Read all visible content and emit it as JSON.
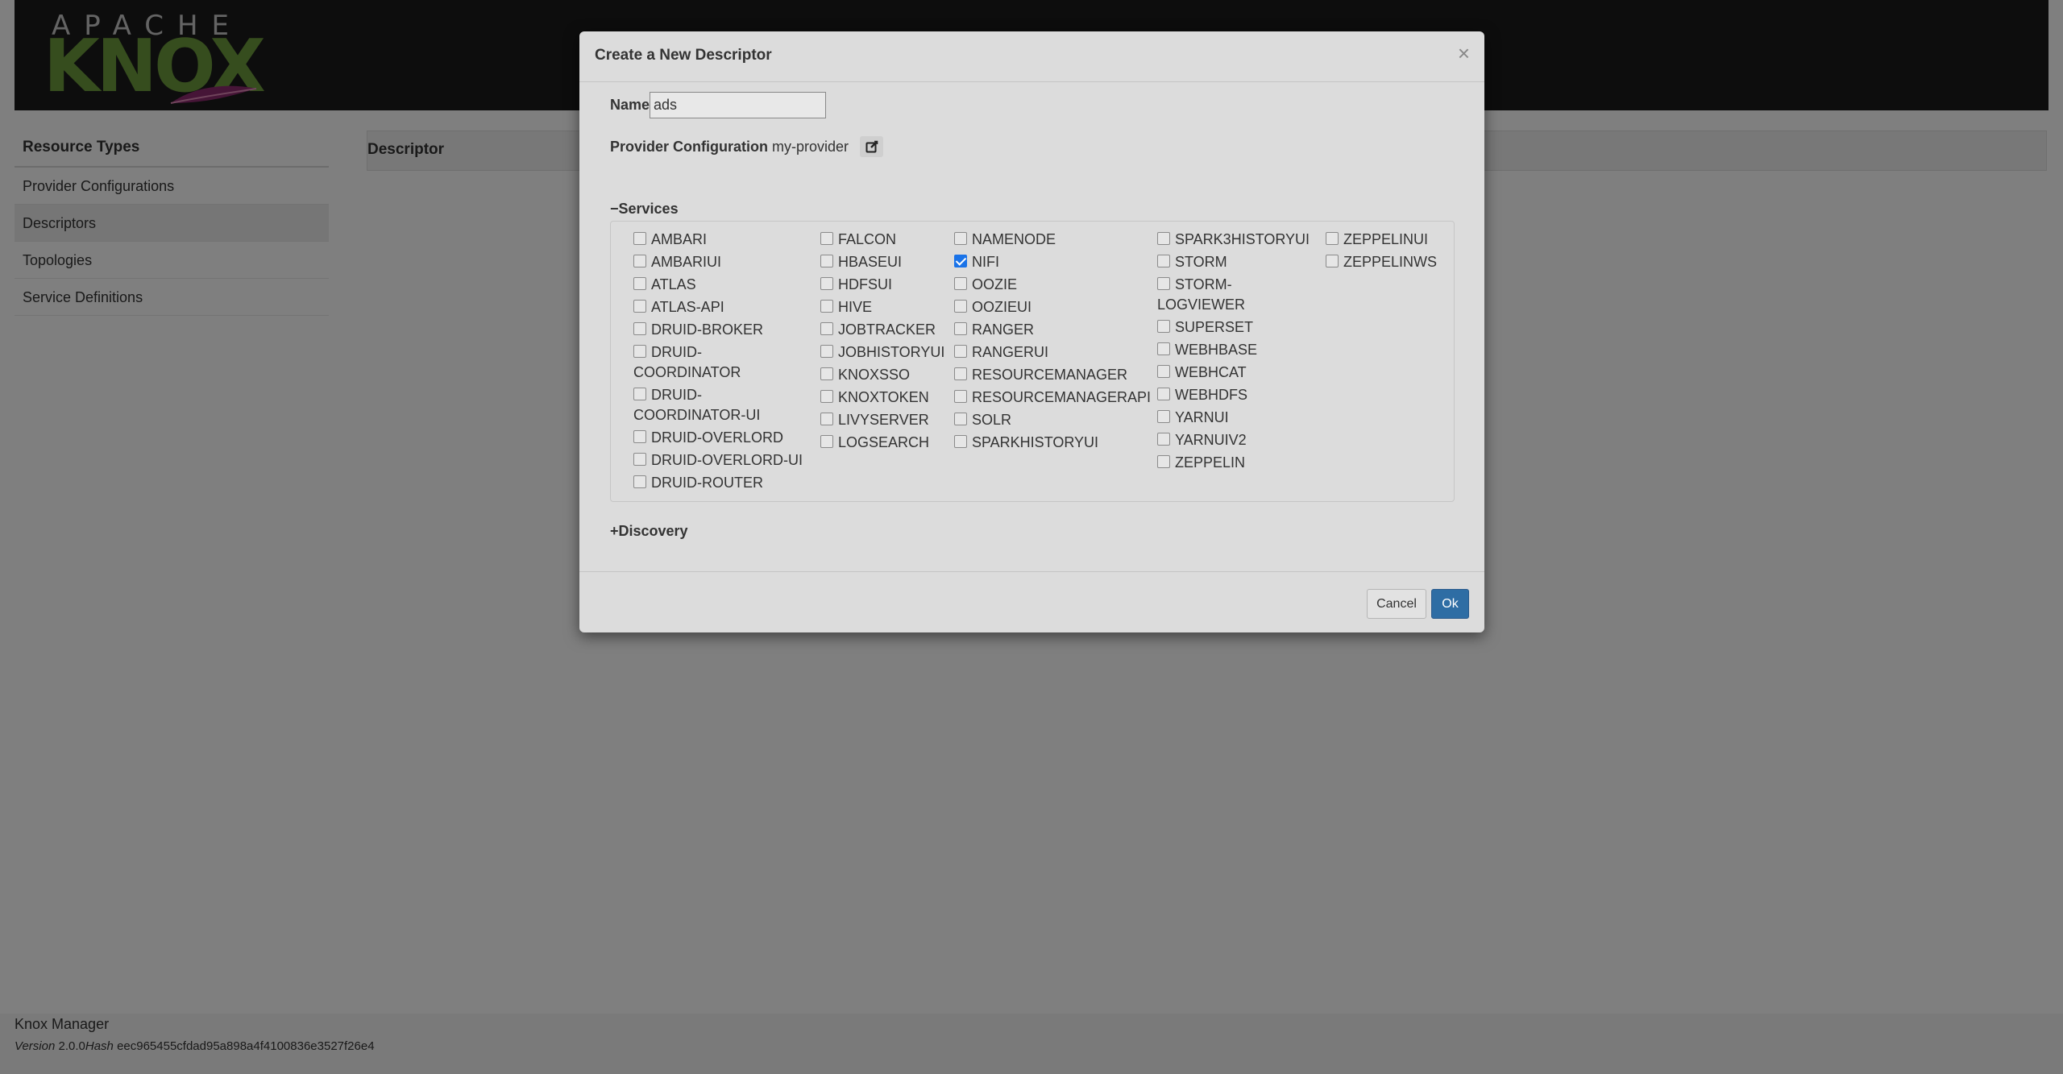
{
  "header": {
    "logo_top": "APACHE",
    "logo_main": "KNOX"
  },
  "sidebar": {
    "title": "Resource Types",
    "items": [
      {
        "label": "Provider Configurations"
      },
      {
        "label": "Descriptors"
      },
      {
        "label": "Topologies"
      },
      {
        "label": "Service Definitions"
      }
    ]
  },
  "main": {
    "title": "Descriptor"
  },
  "footer": {
    "app": "Knox Manager",
    "version_label": "Version",
    "version": "2.0.0",
    "hash_label": "Hash",
    "hash": "eec965455cfdad95a898a4f4100836e3527f26e4"
  },
  "modal": {
    "title": "Create a New Descriptor",
    "close": "×",
    "name_label": "Name",
    "name_value": "ads",
    "provider_label": "Provider Configuration",
    "provider_value": "my-provider",
    "services_toggle": "−Services",
    "discovery_toggle": "+Discovery",
    "cancel": "Cancel",
    "ok": "Ok"
  },
  "services": {
    "col1": [
      {
        "label": "AMBARI",
        "checked": false
      },
      {
        "label": "AMBARIUI",
        "checked": false
      },
      {
        "label": "ATLAS",
        "checked": false
      },
      {
        "label": "ATLAS-API",
        "checked": false
      },
      {
        "label": "DRUID-BROKER",
        "checked": false
      },
      {
        "label": "DRUID-COORDINATOR",
        "checked": false
      },
      {
        "label": "DRUID-COORDINATOR-UI",
        "checked": false
      },
      {
        "label": "DRUID-OVERLORD",
        "checked": false
      },
      {
        "label": "DRUID-OVERLORD-UI",
        "checked": false
      },
      {
        "label": "DRUID-ROUTER",
        "checked": false
      }
    ],
    "col2": [
      {
        "label": "FALCON",
        "checked": false
      },
      {
        "label": "HBASEUI",
        "checked": false
      },
      {
        "label": "HDFSUI",
        "checked": false
      },
      {
        "label": "HIVE",
        "checked": false
      },
      {
        "label": "JOBTRACKER",
        "checked": false
      },
      {
        "label": "JOBHISTORYUI",
        "checked": false
      },
      {
        "label": "KNOXSSO",
        "checked": false
      },
      {
        "label": "KNOXTOKEN",
        "checked": false
      },
      {
        "label": "LIVYSERVER",
        "checked": false
      },
      {
        "label": "LOGSEARCH",
        "checked": false
      }
    ],
    "col3": [
      {
        "label": "NAMENODE",
        "checked": false
      },
      {
        "label": "NIFI",
        "checked": true
      },
      {
        "label": "OOZIE",
        "checked": false
      },
      {
        "label": "OOZIEUI",
        "checked": false
      },
      {
        "label": "RANGER",
        "checked": false
      },
      {
        "label": "RANGERUI",
        "checked": false
      },
      {
        "label": "RESOURCEMANAGER",
        "checked": false
      },
      {
        "label": "RESOURCEMANAGERAPI",
        "checked": false
      },
      {
        "label": "SOLR",
        "checked": false
      },
      {
        "label": "SPARKHISTORYUI",
        "checked": false
      }
    ],
    "col4": [
      {
        "label": "SPARK3HISTORYUI",
        "checked": false
      },
      {
        "label": "STORM",
        "checked": false
      },
      {
        "label": "STORM-LOGVIEWER",
        "checked": false
      },
      {
        "label": "SUPERSET",
        "checked": false
      },
      {
        "label": "WEBHBASE",
        "checked": false
      },
      {
        "label": "WEBHCAT",
        "checked": false
      },
      {
        "label": "WEBHDFS",
        "checked": false
      },
      {
        "label": "YARNUI",
        "checked": false
      },
      {
        "label": "YARNUIV2",
        "checked": false
      },
      {
        "label": "ZEPPELIN",
        "checked": false
      }
    ],
    "col5": [
      {
        "label": "ZEPPELINUI",
        "checked": false
      },
      {
        "label": "ZEPPELINWS",
        "checked": false
      }
    ]
  }
}
